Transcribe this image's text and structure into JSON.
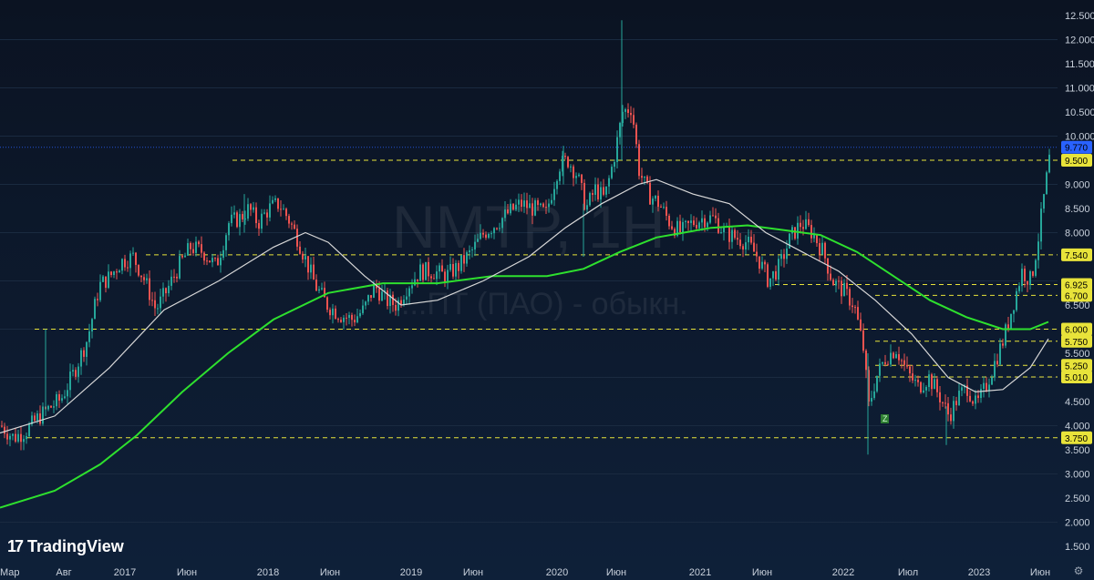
{
  "chart_data": {
    "type": "candlestick",
    "watermark": {
      "symbol": "NMTP, 1H",
      "description": "...ПТ (ПАО) - обыкн."
    },
    "ylim": [
      1.5,
      12.5
    ],
    "y_ticks": [
      "12.500",
      "12.000",
      "11.500",
      "11.000",
      "10.500",
      "10.000",
      "9.000",
      "8.500",
      "8.000",
      "6.500",
      "5.500",
      "4.500",
      "4.000",
      "3.500",
      "3.000",
      "2.500",
      "2.000",
      "1.500"
    ],
    "x_ticks": [
      "Мар",
      "Авг",
      "2017",
      "Июн",
      "2018",
      "Июн",
      "2019",
      "Июн",
      "2020",
      "Июн",
      "2021",
      "Июн",
      "2022",
      "Июл",
      "2023",
      "Июн"
    ],
    "current_price": "9.770",
    "levels": [
      "9.500",
      "7.540",
      "6.925",
      "6.700",
      "6.000",
      "5.750",
      "5.250",
      "5.010",
      "3.750"
    ],
    "marker": "Z",
    "price_path": [
      [
        0,
        4.0
      ],
      [
        14,
        3.75
      ],
      [
        28,
        3.9
      ],
      [
        40,
        4.15
      ],
      [
        52,
        4.35
      ],
      [
        66,
        4.55
      ],
      [
        80,
        5.1
      ],
      [
        95,
        5.8
      ],
      [
        108,
        6.9
      ],
      [
        120,
        7.1
      ],
      [
        132,
        7.4
      ],
      [
        145,
        7.5
      ],
      [
        158,
        7.0
      ],
      [
        170,
        6.4
      ],
      [
        182,
        6.8
      ],
      [
        195,
        7.3
      ],
      [
        208,
        7.7
      ],
      [
        222,
        7.6
      ],
      [
        236,
        7.3
      ],
      [
        250,
        8.2
      ],
      [
        262,
        8.3
      ],
      [
        272,
        8.5
      ],
      [
        282,
        8.2
      ],
      [
        294,
        8.5
      ],
      [
        305,
        8.6
      ],
      [
        315,
        8.3
      ],
      [
        325,
        7.9
      ],
      [
        335,
        7.4
      ],
      [
        345,
        6.9
      ],
      [
        358,
        6.5
      ],
      [
        372,
        6.3
      ],
      [
        386,
        6.2
      ],
      [
        398,
        6.4
      ],
      [
        410,
        6.9
      ],
      [
        422,
        6.6
      ],
      [
        434,
        6.5
      ],
      [
        446,
        6.9
      ],
      [
        460,
        7.2
      ],
      [
        474,
        7.2
      ],
      [
        488,
        7.1
      ],
      [
        502,
        7.3
      ],
      [
        516,
        7.6
      ],
      [
        530,
        8.0
      ],
      [
        544,
        8.2
      ],
      [
        556,
        8.4
      ],
      [
        570,
        8.6
      ],
      [
        584,
        8.5
      ],
      [
        598,
        8.4
      ],
      [
        612,
        9.4
      ],
      [
        622,
        9.5
      ],
      [
        632,
        9.2
      ],
      [
        642,
        8.5
      ],
      [
        652,
        8.9
      ],
      [
        662,
        8.7
      ],
      [
        672,
        9.5
      ],
      [
        682,
        10.5
      ],
      [
        692,
        10.6
      ],
      [
        700,
        9.3
      ],
      [
        710,
        8.8
      ],
      [
        722,
        8.6
      ],
      [
        734,
        8.2
      ],
      [
        746,
        8.0
      ],
      [
        758,
        8.2
      ],
      [
        770,
        8.3
      ],
      [
        782,
        8.3
      ],
      [
        794,
        8.0
      ],
      [
        806,
        7.9
      ],
      [
        818,
        7.8
      ],
      [
        830,
        7.5
      ],
      [
        842,
        7.0
      ],
      [
        854,
        7.3
      ],
      [
        866,
        7.9
      ],
      [
        878,
        8.2
      ],
      [
        890,
        8.0
      ],
      [
        902,
        7.6
      ],
      [
        912,
        7.0
      ],
      [
        924,
        6.8
      ],
      [
        936,
        6.5
      ],
      [
        946,
        5.6
      ],
      [
        952,
        4.4
      ],
      [
        960,
        5.0
      ],
      [
        970,
        5.4
      ],
      [
        982,
        5.6
      ],
      [
        994,
        5.1
      ],
      [
        1006,
        4.8
      ],
      [
        1018,
        5.0
      ],
      [
        1030,
        4.6
      ],
      [
        1040,
        4.2
      ],
      [
        1050,
        4.6
      ],
      [
        1060,
        4.8
      ],
      [
        1070,
        4.4
      ],
      [
        1080,
        4.8
      ],
      [
        1090,
        5.3
      ],
      [
        1100,
        5.8
      ],
      [
        1110,
        6.5
      ],
      [
        1120,
        7.2
      ],
      [
        1130,
        7.0
      ],
      [
        1138,
        7.9
      ],
      [
        1146,
        9.0
      ],
      [
        1152,
        9.77
      ]
    ],
    "spikes": [
      [
        50,
        6.0,
        4.2
      ],
      [
        268,
        8.8,
        8.0
      ],
      [
        618,
        9.8,
        9.0
      ],
      [
        640,
        8.6,
        7.5
      ],
      [
        682,
        12.4,
        9.5
      ],
      [
        952,
        5.5,
        3.4
      ],
      [
        1038,
        4.4,
        3.6
      ]
    ],
    "ma_fast": [
      [
        0,
        3.85
      ],
      [
        60,
        4.2
      ],
      [
        120,
        5.2
      ],
      [
        180,
        6.4
      ],
      [
        240,
        7.0
      ],
      [
        300,
        7.7
      ],
      [
        335,
        8.0
      ],
      [
        360,
        7.8
      ],
      [
        400,
        7.1
      ],
      [
        440,
        6.5
      ],
      [
        480,
        6.6
      ],
      [
        530,
        7.0
      ],
      [
        580,
        7.5
      ],
      [
        620,
        8.1
      ],
      [
        660,
        8.6
      ],
      [
        700,
        9.0
      ],
      [
        720,
        9.1
      ],
      [
        760,
        8.8
      ],
      [
        800,
        8.6
      ],
      [
        840,
        8.0
      ],
      [
        880,
        7.6
      ],
      [
        920,
        7.2
      ],
      [
        960,
        6.6
      ],
      [
        1000,
        5.9
      ],
      [
        1040,
        5.0
      ],
      [
        1070,
        4.7
      ],
      [
        1100,
        4.75
      ],
      [
        1130,
        5.2
      ],
      [
        1150,
        5.8
      ]
    ],
    "ma_slow": [
      [
        0,
        2.3
      ],
      [
        60,
        2.65
      ],
      [
        110,
        3.2
      ],
      [
        150,
        3.8
      ],
      [
        200,
        4.7
      ],
      [
        250,
        5.5
      ],
      [
        300,
        6.2
      ],
      [
        360,
        6.75
      ],
      [
        420,
        6.95
      ],
      [
        480,
        6.95
      ],
      [
        540,
        7.1
      ],
      [
        600,
        7.1
      ],
      [
        640,
        7.25
      ],
      [
        680,
        7.6
      ],
      [
        720,
        7.9
      ],
      [
        780,
        8.1
      ],
      [
        820,
        8.15
      ],
      [
        860,
        8.05
      ],
      [
        900,
        7.95
      ],
      [
        940,
        7.6
      ],
      [
        980,
        7.1
      ],
      [
        1020,
        6.6
      ],
      [
        1060,
        6.25
      ],
      [
        1100,
        6.0
      ],
      [
        1130,
        6.0
      ],
      [
        1150,
        6.15
      ]
    ]
  },
  "branding": {
    "logo_text": "TradingView",
    "logo_mark": "17"
  },
  "colors": {
    "up": "#26a69a",
    "down": "#ef5350",
    "ma_fast": "#d8d8d8",
    "ma_slow": "#2ee02e",
    "level": "#e8e33a",
    "current": "#2962ff",
    "grid": "#1a2a40"
  }
}
